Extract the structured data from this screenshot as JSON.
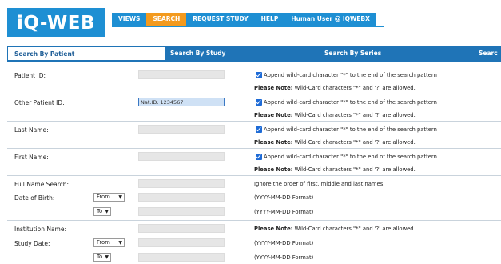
{
  "header": {
    "logo": "iQ-WEB",
    "nav": [
      {
        "label": "VIEWS",
        "active": false
      },
      {
        "label": "SEARCH",
        "active": true
      },
      {
        "label": "REQUEST STUDY",
        "active": false
      },
      {
        "label": "HELP",
        "active": false
      },
      {
        "label": "Human User @ IQWEBX",
        "active": false
      }
    ]
  },
  "tabs": [
    {
      "label": "Search By Patient",
      "active": true
    },
    {
      "label": "Search By Study",
      "active": false
    },
    {
      "label": "Search By Series",
      "active": false
    },
    {
      "label": "Searc",
      "active": false
    }
  ],
  "form": {
    "patient_id": {
      "label": "Patient ID:",
      "value": ""
    },
    "other_patient_id": {
      "label": "Other Patient ID:",
      "value": "Nat.ID. 1234567"
    },
    "last_name": {
      "label": "Last Name:",
      "value": ""
    },
    "first_name": {
      "label": "First Name:",
      "value": ""
    },
    "full_name_search": {
      "label": "Full Name Search:",
      "value": "",
      "note": "Ignore the order of first, middle and last names."
    },
    "date_of_birth": {
      "label": "Date of Birth:",
      "from_label": "From",
      "to_label": "To",
      "from_value": "",
      "to_value": "",
      "format": "(YYYY-MM-DD Format)"
    },
    "institution_name": {
      "label": "Institution Name:",
      "value": ""
    },
    "study_date": {
      "label": "Study Date:",
      "from_label": "From",
      "to_label": "To",
      "from_value": "",
      "to_value": "",
      "format": "(YYYY-MM-DD Format)"
    },
    "append_wildcard_text": "Append wild-card character \"*\" to the end of the search pattern",
    "please_note_bold": "Please Note:",
    "please_note_text": " Wild-Card characters \"*\" and '?' are allowed."
  },
  "colors": {
    "brand_blue": "#1e8fd3",
    "tab_blue": "#1f74b7",
    "active_orange": "#f39a1e"
  }
}
